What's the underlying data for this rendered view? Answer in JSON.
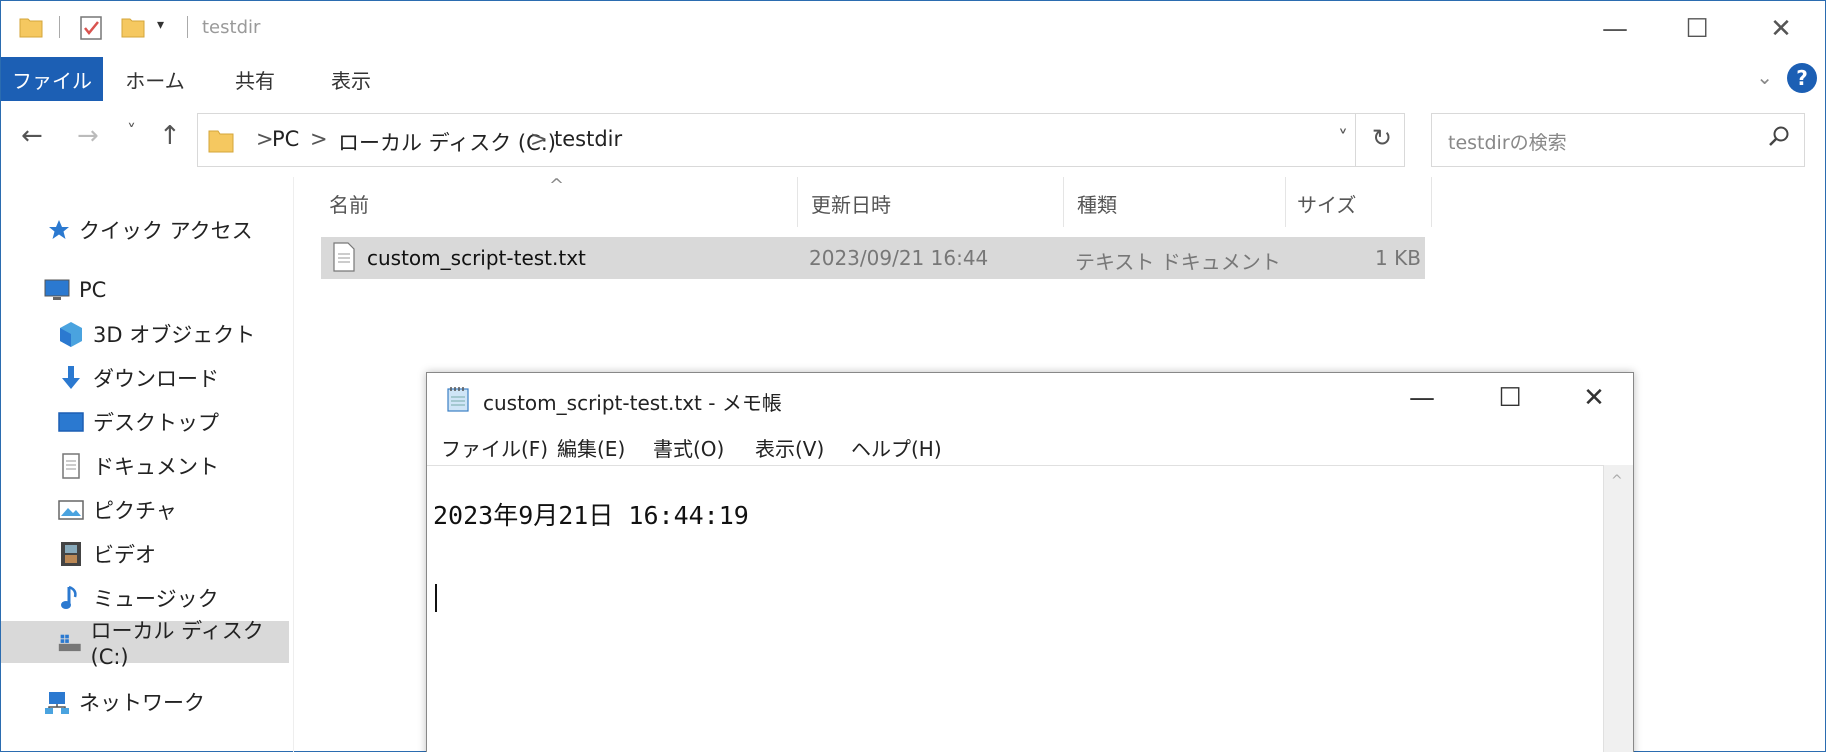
{
  "explorer": {
    "title": "testdir",
    "window_controls": {
      "minimize": "—",
      "maximize": "☐",
      "close": "✕"
    },
    "ribbon": {
      "tabs": [
        "ファイル",
        "ホーム",
        "共有",
        "表示"
      ],
      "help": "?"
    },
    "nav": {
      "back": "←",
      "forward": "→",
      "recent": "˅",
      "up": "↑"
    },
    "address": {
      "crumbs": [
        "PC",
        "ローカル ディスク (C:)",
        "testdir"
      ],
      "separator": ">",
      "dropdown": "˅",
      "refresh": "↻"
    },
    "search": {
      "placeholder": "testdirの検索"
    },
    "sidebar": {
      "items": [
        {
          "label": "クイック アクセス",
          "icon": "star-icon"
        },
        {
          "label": "PC",
          "icon": "monitor-icon"
        },
        {
          "label": "3D オブジェクト",
          "icon": "cube-icon"
        },
        {
          "label": "ダウンロード",
          "icon": "download-arrow-icon"
        },
        {
          "label": "デスクトップ",
          "icon": "desktop-icon"
        },
        {
          "label": "ドキュメント",
          "icon": "document-icon"
        },
        {
          "label": "ピクチャ",
          "icon": "picture-icon"
        },
        {
          "label": "ビデオ",
          "icon": "film-icon"
        },
        {
          "label": "ミュージック",
          "icon": "music-note-icon"
        },
        {
          "label": "ローカル ディスク (C:)",
          "icon": "drive-icon",
          "selected": true
        },
        {
          "label": "ネットワーク",
          "icon": "network-icon"
        }
      ]
    },
    "columns": [
      "名前",
      "更新日時",
      "種類",
      "サイズ"
    ],
    "sort_indicator": "^",
    "files": [
      {
        "name": "custom_script-test.txt",
        "modified": "2023/09/21 16:44",
        "type": "テキスト ドキュメント",
        "size": "1 KB"
      }
    ]
  },
  "notepad": {
    "title": "custom_script-test.txt - メモ帳",
    "window_controls": {
      "minimize": "—",
      "maximize": "☐",
      "close": "✕"
    },
    "menu": [
      "ファイル(F)",
      "編集(E)",
      "書式(O)",
      "表示(V)",
      "ヘルプ(H)"
    ],
    "content": "2023年9月21日 16:44:19",
    "scroll_up": "^"
  },
  "colors": {
    "accent": "#1c5fb4",
    "selection": "#d9d9d9",
    "folder": "#f5c860"
  }
}
